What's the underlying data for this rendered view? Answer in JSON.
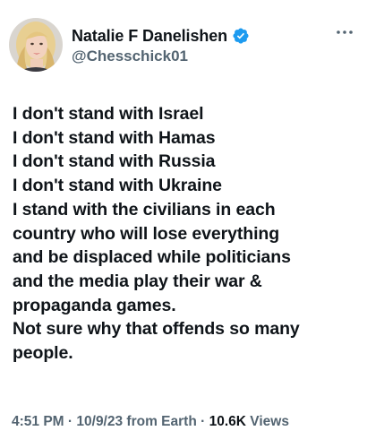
{
  "author": {
    "display_name": "Natalie F Danelishen",
    "handle": "@Chesschick01",
    "verified": true,
    "avatar_icon": "profile-photo",
    "badge_icon": "verified-badge-icon",
    "badge_color": "#1d9bf0"
  },
  "more_icon": "more-options-icon",
  "tweet_lines": [
    "I don't stand with Israel",
    "I don't stand with Hamas",
    "I don't stand with Russia",
    "I don't stand with Ukraine",
    "I stand with the civilians in each",
    "country who will lose everything",
    "and be displaced while politicians",
    "and the media play their war &",
    "propaganda games.",
    "Not sure why that offends so many",
    "people."
  ],
  "meta": {
    "time": "4:51 PM",
    "date": "10/9/23",
    "source": "from Earth",
    "separator": "·",
    "views_count": "10.6K",
    "views_label": "Views"
  }
}
